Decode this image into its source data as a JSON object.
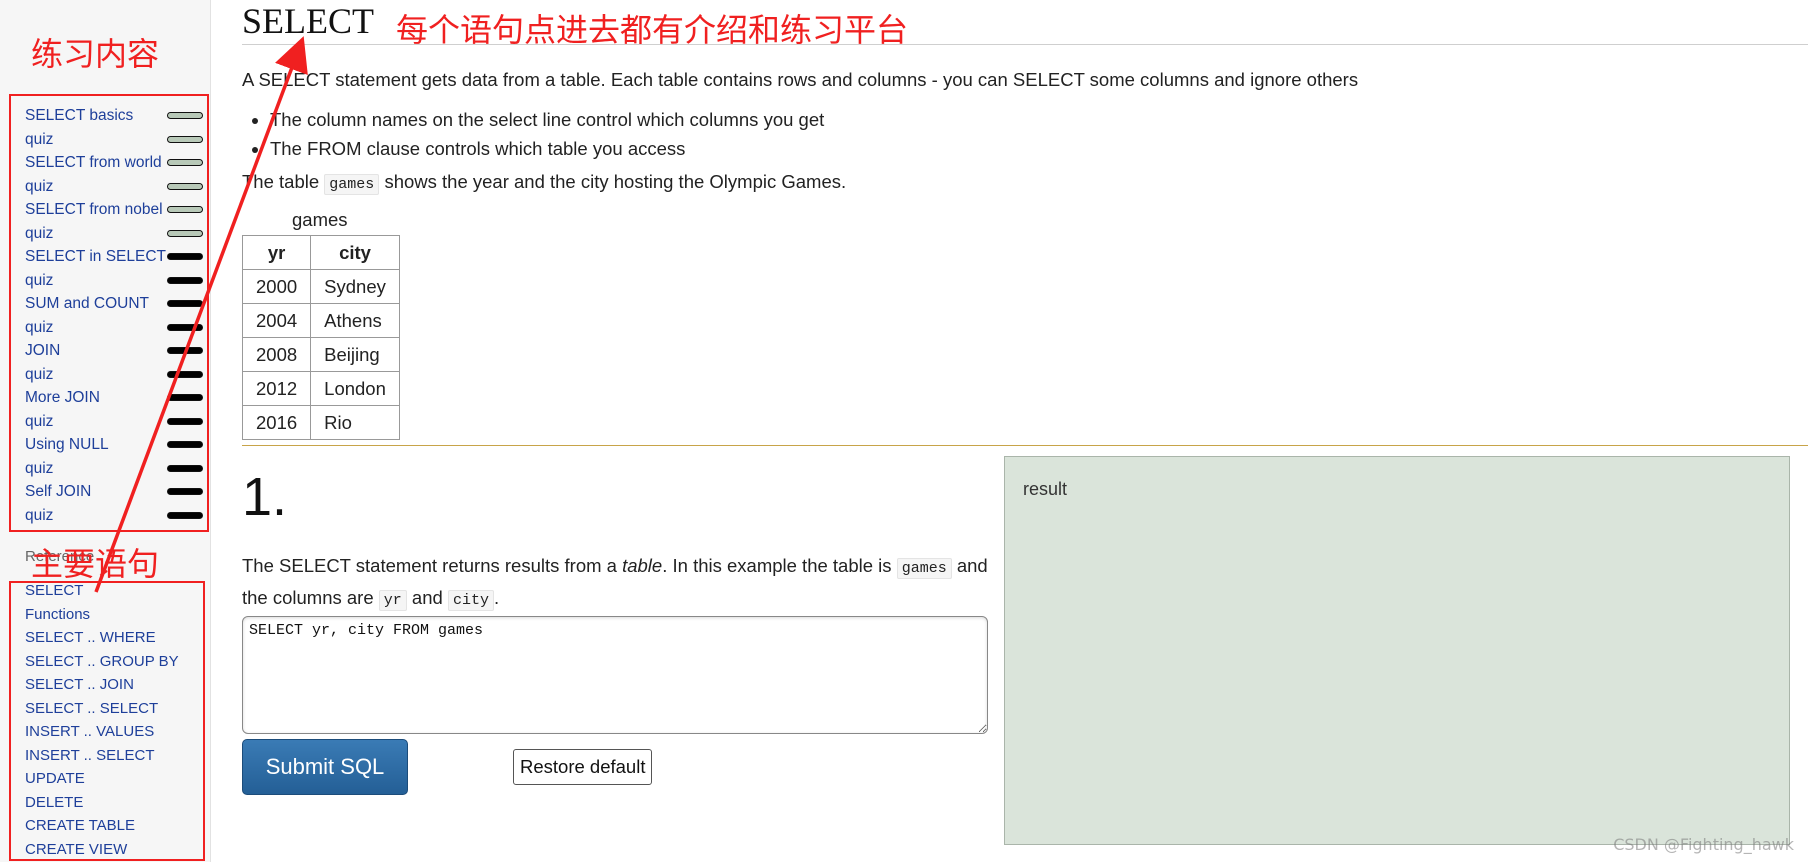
{
  "sidebar": {
    "items": [
      {
        "label": "SELECT basics",
        "progress": "done"
      },
      {
        "label": "quiz",
        "progress": "done"
      },
      {
        "label": "SELECT from world",
        "progress": "done"
      },
      {
        "label": "quiz",
        "progress": "done"
      },
      {
        "label": "SELECT from nobel",
        "progress": "done"
      },
      {
        "label": "quiz",
        "progress": "done"
      },
      {
        "label": "SELECT in SELECT",
        "progress": "todo"
      },
      {
        "label": "quiz",
        "progress": "todo"
      },
      {
        "label": "SUM and COUNT",
        "progress": "todo"
      },
      {
        "label": "quiz",
        "progress": "todo"
      },
      {
        "label": "JOIN",
        "progress": "todo"
      },
      {
        "label": "quiz",
        "progress": "todo"
      },
      {
        "label": "More JOIN",
        "progress": "todo"
      },
      {
        "label": "quiz",
        "progress": "todo"
      },
      {
        "label": "Using NULL",
        "progress": "todo"
      },
      {
        "label": "quiz",
        "progress": "todo"
      },
      {
        "label": "Self JOIN",
        "progress": "todo"
      },
      {
        "label": "quiz",
        "progress": "todo"
      }
    ],
    "reference_heading": "Reference",
    "reference_items": [
      "SELECT",
      "Functions",
      "SELECT .. WHERE",
      "SELECT .. GROUP BY",
      "SELECT .. JOIN",
      "SELECT .. SELECT",
      "INSERT .. VALUES",
      "INSERT .. SELECT",
      "UPDATE",
      "DELETE",
      "CREATE TABLE",
      "CREATE VIEW"
    ]
  },
  "annotations": {
    "practice_content": "练习内容",
    "main_statements": "主要语句",
    "intro_note": "每个语句点进去都有介绍和练习平台",
    "color": "#f02020"
  },
  "main": {
    "title": "SELECT",
    "intro": "A SELECT statement gets data from a table. Each table contains rows and columns - you can SELECT some columns and ignore others",
    "bullets": [
      "The column names on the select line control which columns you get",
      "The FROM clause controls which table you access"
    ],
    "table_intro_before": "The table",
    "table_intro_code": "games",
    "table_intro_after": "shows the year and the city hosting the Olympic Games.",
    "games_table": {
      "caption": "games",
      "columns": [
        "yr",
        "city"
      ],
      "rows": [
        [
          "2000",
          "Sydney"
        ],
        [
          "2004",
          "Athens"
        ],
        [
          "2008",
          "Beijing"
        ],
        [
          "2012",
          "London"
        ],
        [
          "2016",
          "Rio"
        ]
      ]
    },
    "question": {
      "number": "1.",
      "text_part1": "The SELECT statement returns results from a",
      "text_italic": "table",
      "text_part2": ". In this example the table is",
      "code_table": "games",
      "text_part3": "and the columns are",
      "code_col1": "yr",
      "text_and": "and",
      "code_col2": "city",
      "text_end": "."
    },
    "sql_editor_value": "SELECT yr, city FROM games",
    "submit_label": "Submit SQL",
    "restore_label": "Restore default",
    "result_label": "result"
  },
  "watermark": "CSDN @Fighting_hawk",
  "colors": {
    "link": "#1e3f9a",
    "result_bg": "#dae4da",
    "submit_bg": "#2e6da4",
    "gold_rule": "#c8a449"
  }
}
